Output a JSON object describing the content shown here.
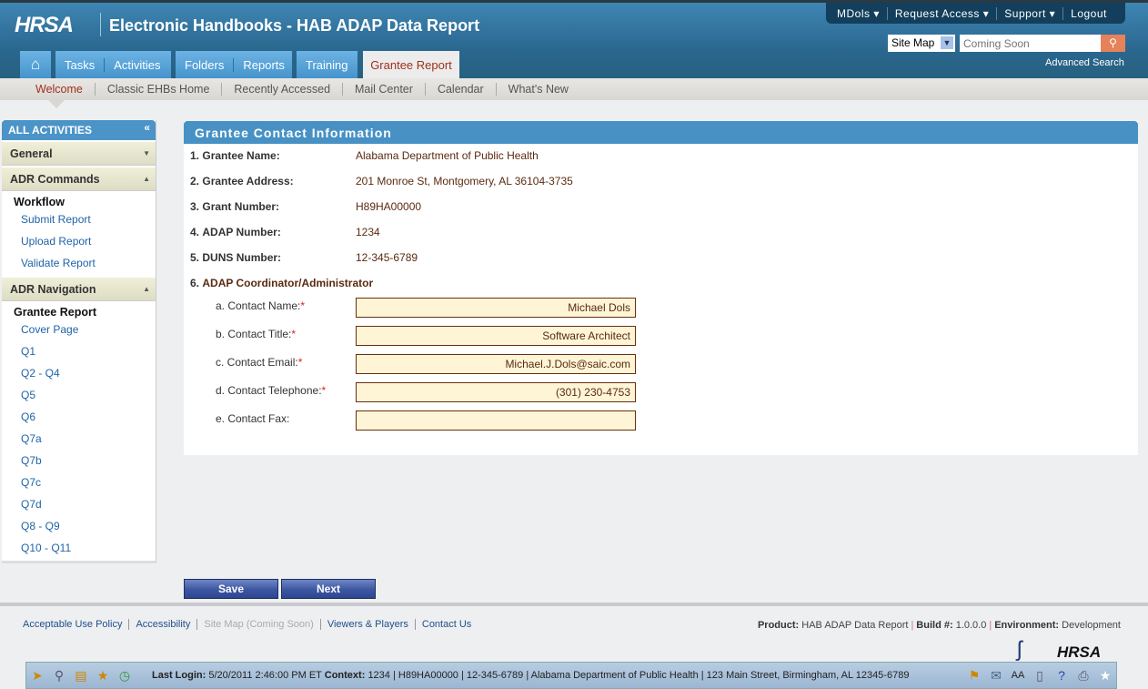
{
  "header": {
    "logo": "HRSA",
    "title": "Electronic Handbooks - HAB ADAP Data Report",
    "top_nav": [
      "MDols ▾",
      "Request Access ▾",
      "Support ▾",
      "Logout"
    ],
    "site_map_select": "Site Map",
    "search_placeholder": "Coming Soon",
    "advanced_search": "Advanced Search",
    "tabs": {
      "home": "⌂",
      "tasks": "Tasks",
      "activities": "Activities",
      "folders": "Folders",
      "reports": "Reports",
      "training": "Training",
      "grantee_report": "Grantee Report"
    },
    "subnav": [
      "Welcome",
      "Classic EHBs Home",
      "Recently Accessed",
      "Mail Center",
      "Calendar",
      "What's New"
    ]
  },
  "sidebar": {
    "title": "ALL ACTIVITIES",
    "collapse": "«",
    "general": "General",
    "adr_commands": "ADR Commands",
    "workflow": "Workflow",
    "workflow_links": [
      "Submit Report",
      "Upload Report",
      "Validate Report"
    ],
    "adr_navigation": "ADR Navigation",
    "grantee_report": "Grantee Report",
    "nav_links": [
      "Cover Page",
      "Q1",
      "Q2 - Q4",
      "Q5",
      "Q6",
      "Q7a",
      "Q7b",
      "Q7c",
      "Q7d",
      "Q8 - Q9",
      "Q10 - Q11"
    ]
  },
  "panel": {
    "title": "Grantee Contact Information",
    "fields": [
      {
        "num": "1.",
        "label": "Grantee Name:",
        "value": "Alabama Department of Public Health"
      },
      {
        "num": "2.",
        "label": "Grantee Address:",
        "value": "201 Monroe St, Montgomery, AL 36104-3735"
      },
      {
        "num": "3.",
        "label": "Grant Number:",
        "value": "H89HA00000"
      },
      {
        "num": "4.",
        "label": "ADAP Number:",
        "value": "1234"
      },
      {
        "num": "5.",
        "label": "DUNS Number:",
        "value": "12-345-6789"
      }
    ],
    "coord_num": "6.",
    "coord_label": "ADAP Coordinator/Administrator",
    "contacts": [
      {
        "label": "a. Contact Name:",
        "req": "*",
        "value": "Michael Dols"
      },
      {
        "label": "b. Contact Title:",
        "req": "*",
        "value": "Software Architect"
      },
      {
        "label": "c. Contact Email:",
        "req": "*",
        "value": "Michael.J.Dols@saic.com"
      },
      {
        "label": "d. Contact Telephone:",
        "req": "*",
        "value": "(301) 230-4753"
      },
      {
        "label": "e. Contact Fax:",
        "req": "",
        "value": ""
      }
    ]
  },
  "buttons": {
    "save": "Save",
    "next": "Next"
  },
  "footer": {
    "links": [
      "Acceptable Use Policy",
      "Accessibility",
      "Site Map (Coming Soon)",
      "Viewers & Players",
      "Contact Us"
    ],
    "product_label": "Product:",
    "product": "HAB ADAP Data Report",
    "build_label": "Build #:",
    "build": "1.0.0.0",
    "env_label": "Environment:",
    "env": "Development",
    "logo": "HRSA"
  },
  "toolbar": {
    "last_login_label": "Last Login:",
    "last_login": "5/20/2011 2:46:00 PM ET",
    "context_label": "Context:",
    "context": "1234 | H89HA00000 | 12-345-6789 | Alabama Department of Public Health | 123 Main Street, Birmingham, AL 12345-6789"
  }
}
